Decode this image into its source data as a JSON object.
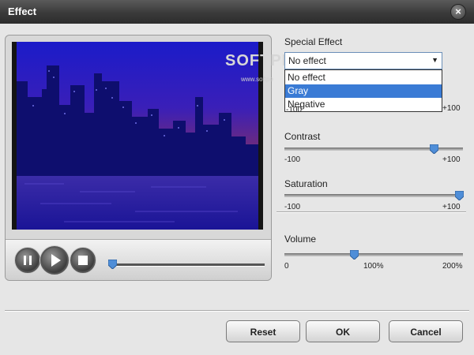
{
  "window": {
    "title": "Effect"
  },
  "special_effect": {
    "label": "Special Effect",
    "selected": "No effect",
    "options": [
      "No effect",
      "Gray",
      "Negative"
    ],
    "highlighted": "Gray"
  },
  "brightness": {
    "min_label": "-100",
    "max_label": "+100",
    "level": 0.5
  },
  "contrast": {
    "label": "Contrast",
    "min_label": "-100",
    "max_label": "+100",
    "level": 0.84
  },
  "saturation": {
    "label": "Saturation",
    "min_label": "-100",
    "max_label": "+100",
    "level": 0.98
  },
  "volume": {
    "label": "Volume",
    "min_label": "0",
    "mid_label": "100%",
    "max_label": "200%",
    "level": 0.39
  },
  "player": {
    "seek_level": 0.02
  },
  "watermark": {
    "text": "SOFTPE",
    "sub": "www.softpe"
  },
  "buttons": {
    "reset": "Reset",
    "ok": "OK",
    "cancel": "Cancel"
  },
  "colors": {
    "accent": "#3a7bd5",
    "titlebar": "#3a3a3a"
  }
}
